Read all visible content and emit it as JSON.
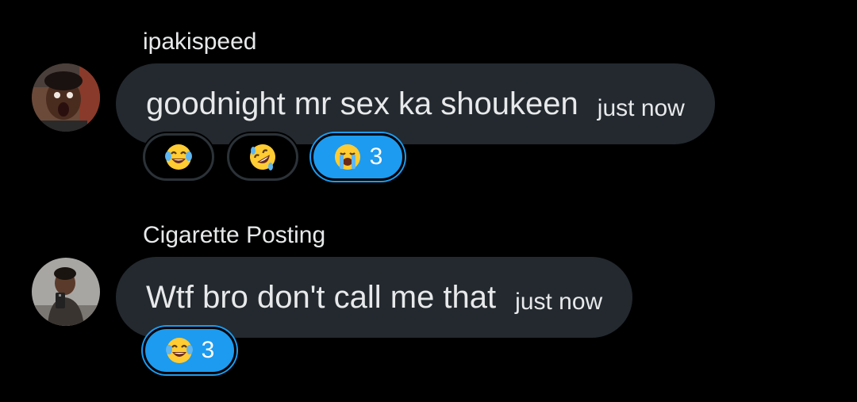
{
  "messages": [
    {
      "sender": "ipakispeed",
      "text": "goodnight mr sex ka shoukeen",
      "timestamp": "just now",
      "reactions": [
        {
          "emoji": "face-with-tears-of-joy",
          "count": ""
        },
        {
          "emoji": "rolling-on-floor-laughing",
          "count": ""
        },
        {
          "emoji": "loudly-crying-face",
          "count": "3",
          "selected": true
        }
      ]
    },
    {
      "sender": "Cigarette Posting",
      "text": "Wtf bro don't call me that",
      "timestamp": "just now",
      "reactions": [
        {
          "emoji": "face-with-tears-of-joy",
          "count": "3",
          "selected": true
        }
      ]
    }
  ],
  "colors": {
    "background": "#000000",
    "bubble": "#23292f",
    "text": "#e7e9ea",
    "accent": "#1d9bf0"
  }
}
